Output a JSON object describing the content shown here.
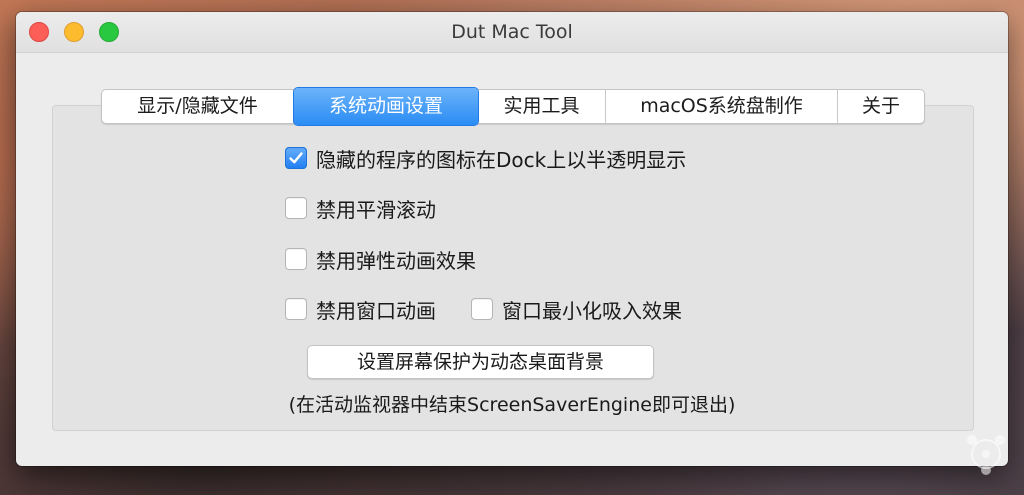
{
  "window": {
    "title": "Dut Mac Tool"
  },
  "tabs": [
    {
      "label": "显示/隐藏文件",
      "active": false
    },
    {
      "label": "系统动画设置",
      "active": true
    },
    {
      "label": "实用工具",
      "active": false
    },
    {
      "label": "macOS系统盘制作",
      "active": false
    },
    {
      "label": "关于",
      "active": false
    }
  ],
  "options": {
    "dock_translucent": {
      "label": "隐藏的程序的图标在Dock上以半透明显示",
      "checked": true
    },
    "disable_smooth_scroll": {
      "label": "禁用平滑滚动",
      "checked": false
    },
    "disable_elastic": {
      "label": "禁用弹性动画效果",
      "checked": false
    },
    "disable_window_anim": {
      "label": "禁用窗口动画",
      "checked": false
    },
    "minimize_suck": {
      "label": "窗口最小化吸入效果",
      "checked": false
    }
  },
  "action": {
    "screensaver_button": "设置屏幕保护为动态桌面背景",
    "hint": "(在活动监视器中结束ScreenSaverEngine即可退出)"
  },
  "colors": {
    "accent": "#2a8cf4",
    "close": "#fc5f57",
    "minimize": "#fdbc2e",
    "maximize": "#28c840"
  }
}
